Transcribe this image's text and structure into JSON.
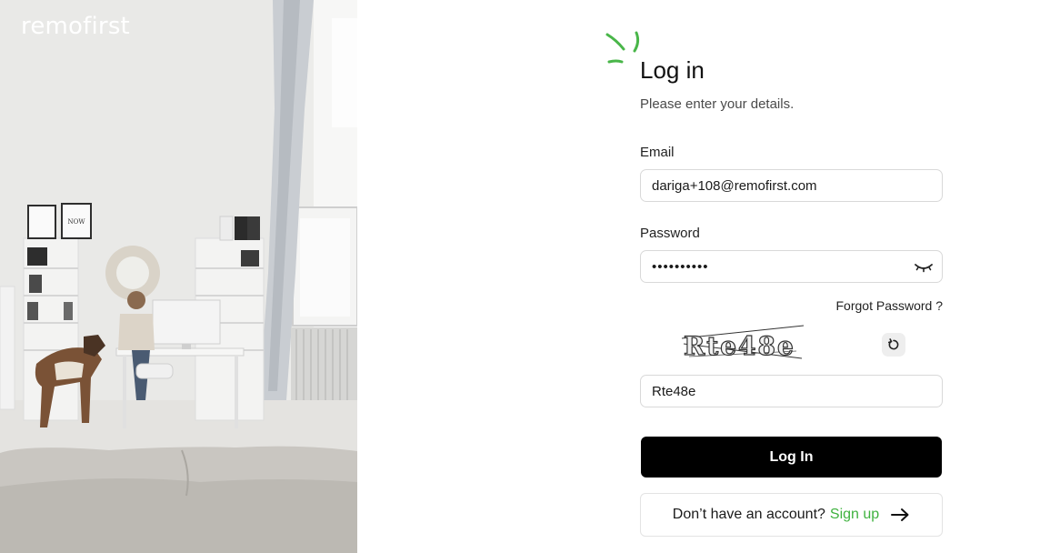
{
  "brand": {
    "logo_text": "remofirst"
  },
  "hero": {
    "poster_text": "NOW"
  },
  "header": {
    "title": "Log in",
    "subtitle": "Please enter your details."
  },
  "form": {
    "email": {
      "label": "Email",
      "value": "dariga+108@remofirst.com"
    },
    "password": {
      "label": "Password",
      "masked_value": "••••••••••"
    },
    "forgot_password": "Forgot Password ?",
    "captcha": {
      "image_text": "Rte48e",
      "input_value": "Rte48e"
    },
    "submit_label": "Log In"
  },
  "signup": {
    "prompt": "Don’t have an account?",
    "link": "Sign up"
  },
  "colors": {
    "accent_green": "#3fb23f",
    "button_black": "#000000"
  },
  "icons": {
    "spark": "spark-icon",
    "eye": "eye-closed-icon",
    "refresh": "refresh-icon",
    "arrow": "arrow-right-icon"
  }
}
